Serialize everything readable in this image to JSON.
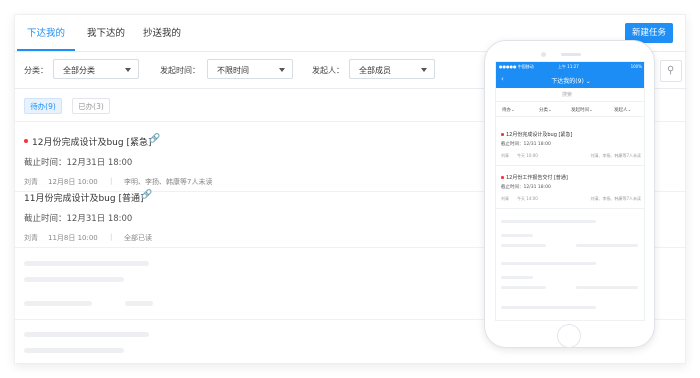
{
  "tabs": [
    {
      "label": "下达我的",
      "active": true
    },
    {
      "label": "我下达的",
      "active": false
    },
    {
      "label": "抄送我的",
      "active": false
    }
  ],
  "new_task_label": "新建任务",
  "filters": [
    {
      "label": "分类：",
      "value": "全部分类"
    },
    {
      "label": "发起时间：",
      "value": "不限时间"
    },
    {
      "label": "发起人：",
      "value": "全部成员"
    }
  ],
  "status_tabs": [
    {
      "label": "待办(9)",
      "active": true
    },
    {
      "label": "已办(3)",
      "active": false
    }
  ],
  "tasks": [
    {
      "title": "12月份完成设计及bug [紧急]",
      "urgent": true,
      "deadline": "截止时间：12月31日 18:00",
      "creator": "刘青",
      "date": "12月8日 10:00",
      "people": "李明、李扬、韩康等7人未读"
    },
    {
      "title": "11月份完成设计及bug [普通]",
      "urgent": false,
      "deadline": "截止时间：12月31日 18:00",
      "creator": "刘青",
      "date": "11月8日 10:00",
      "people": "全部已读"
    }
  ],
  "phone": {
    "status_carrier": "●●●●● 中国移动",
    "status_time": "上午 11:27",
    "status_battery": "100%",
    "title": "下达我的(9) ⌄",
    "search_placeholder": "搜索",
    "filters": [
      "待办⌄",
      "分类⌄",
      "发起时间⌄",
      "发起人⌄"
    ],
    "tasks": [
      {
        "title": "12月份完成设计及bug [紧急]",
        "deadline": "截止时间：12/31 18:00",
        "creator": "刘青",
        "date": "今天 10:00",
        "people": "刘清、李扬、韩康等7人未读"
      },
      {
        "title": "12月份工作报告交付 [普通]",
        "deadline": "截止时间：12/31 18:00",
        "creator": "刘青",
        "date": "今天 14:00",
        "people": "刘清、李扬、韩康等7人未读"
      }
    ]
  },
  "colors": {
    "accent": "#1f8ef5",
    "urgent_dot": "#f0373a",
    "skeleton": "#edeff2"
  },
  "icons": {
    "attachment": "paperclip-icon",
    "search": "search-icon",
    "dropdown": "chevron-down-icon",
    "back": "back-arrow-icon"
  }
}
